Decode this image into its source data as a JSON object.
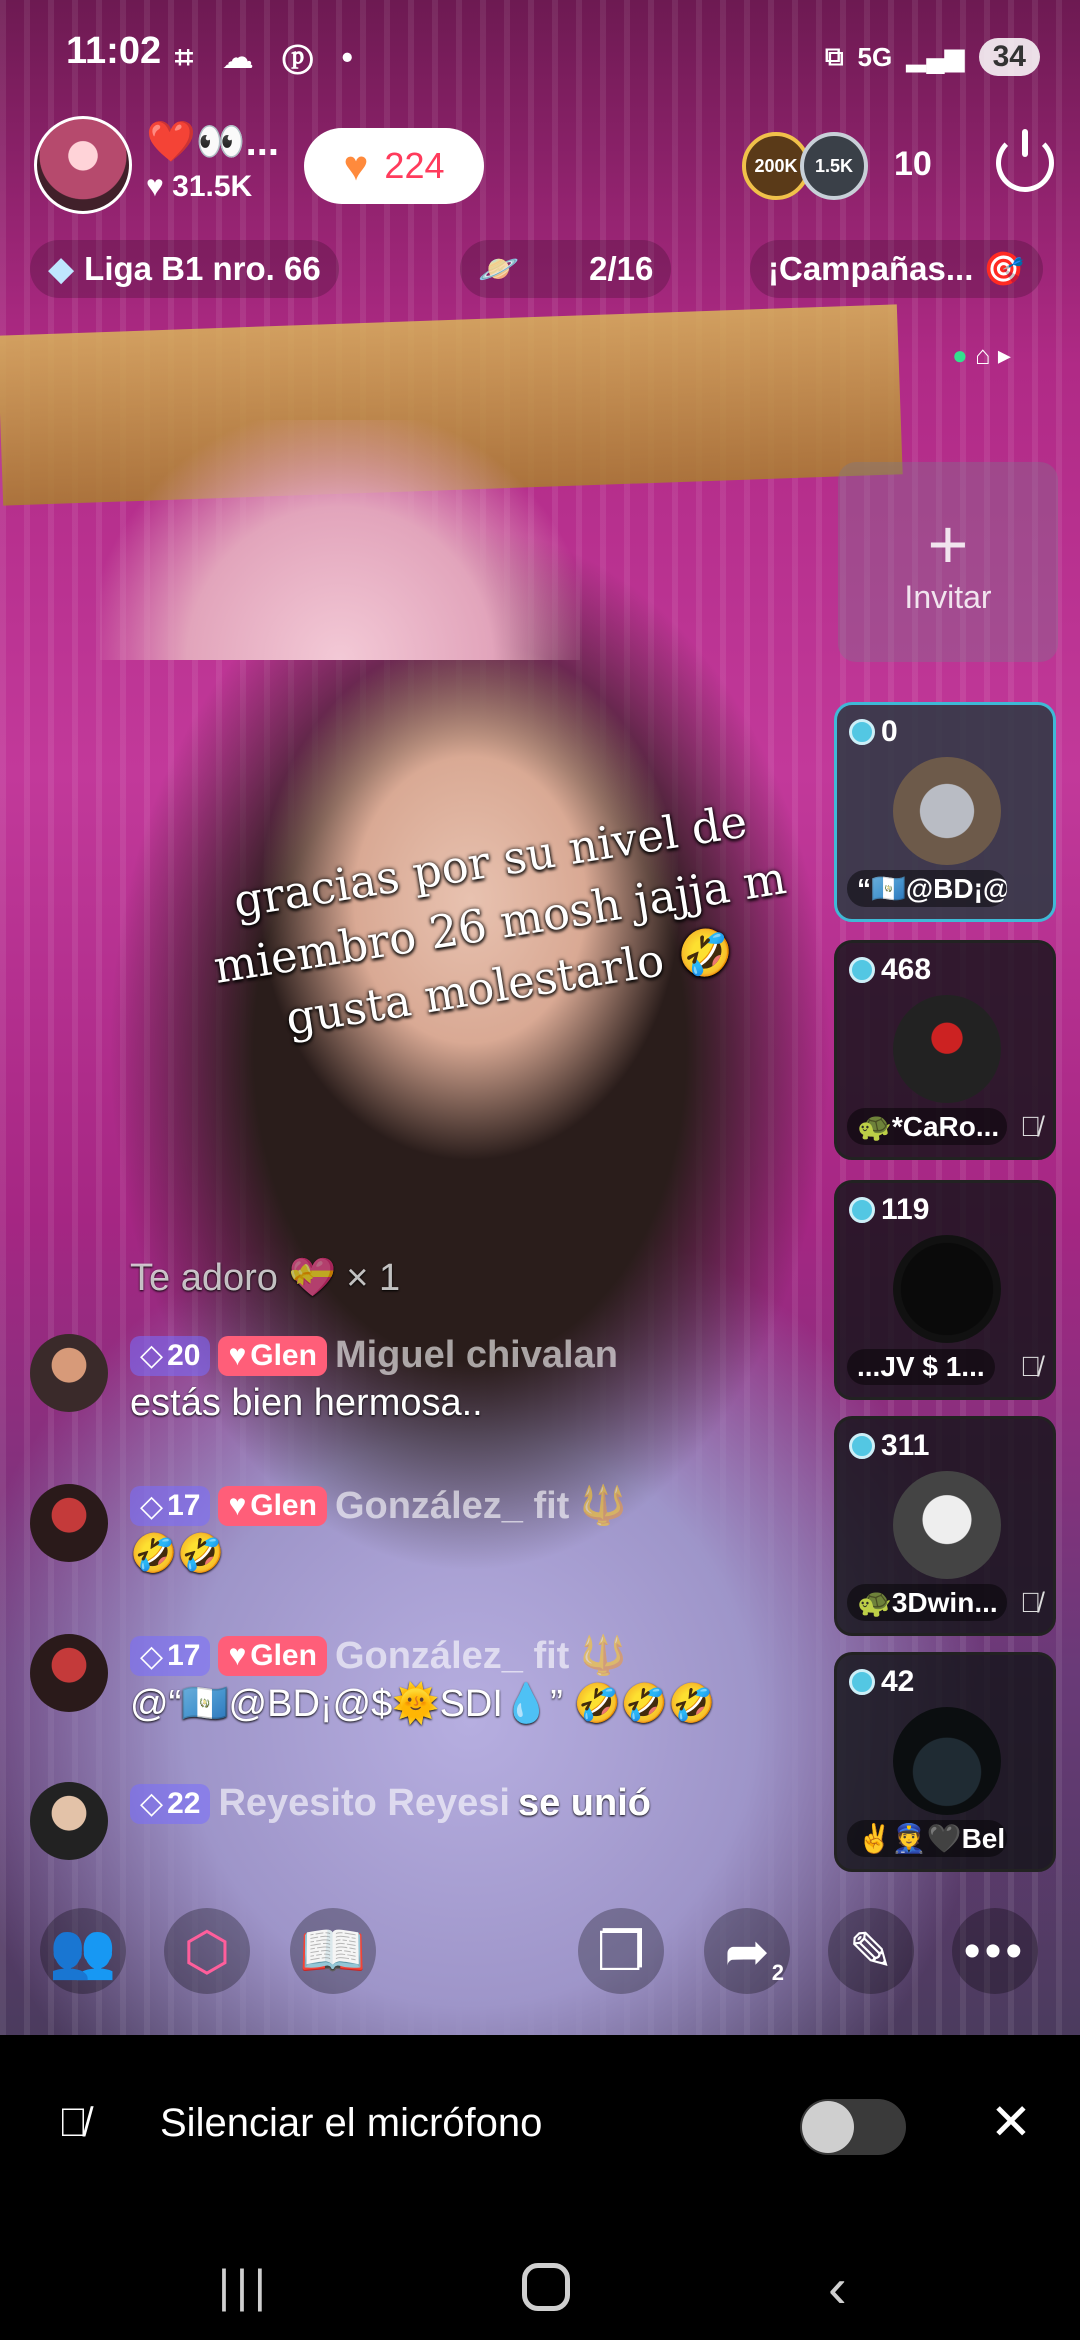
{
  "status_bar": {
    "time": "11:02",
    "icons": "⌗ ☁ ⓟ •",
    "network": "5G",
    "signal": "▂▄▆",
    "battery": "34"
  },
  "host": {
    "name": "❤️👀...",
    "likes": "♥ 31.5K",
    "follow_count": "224"
  },
  "viewers": {
    "badge1": "200K",
    "badge2": "1.5K",
    "count": "10"
  },
  "pills": {
    "league": "Liga B1 nro. 66",
    "rank_icon": "🪐",
    "rank": "2/16",
    "campaigns": "¡Campañas..."
  },
  "caption": "gracias por su nivel de miembro 26 mosh jajja m gusta molestarlo 🤣",
  "invite": {
    "label": "Invitar"
  },
  "guests": [
    {
      "score": "0",
      "name": "“🇬🇹@BD¡@..."
    },
    {
      "score": "468",
      "name": "🐢*CaRo..."
    },
    {
      "score": "119",
      "name": "...JV  $  1..."
    },
    {
      "score": "311",
      "name": "🐢3Dwin..."
    },
    {
      "score": "42",
      "name": "✌️👮🖤Beli..."
    }
  ],
  "chat": [
    {
      "text": "Te adoro 💝 × 1"
    },
    {
      "level": "20",
      "fan": "Glen",
      "user": "Miguel chivalan",
      "message": "estás bien hermosa.."
    },
    {
      "level": "17",
      "fan": "Glen",
      "user": "González_ fit 🔱",
      "message": "🤣🤣"
    },
    {
      "level": "17",
      "fan": "Glen",
      "user": "González_ fit 🔱",
      "message": "@“🇬🇹@BD¡@$🌞SDI💧” 🤣🤣🤣"
    },
    {
      "level": "22",
      "user": "Reyesito Reyesi",
      "message": "se unió"
    }
  ],
  "toolbar": {
    "share_count": "2"
  },
  "mic_bar": {
    "label": "Silenciar el micrófono"
  }
}
